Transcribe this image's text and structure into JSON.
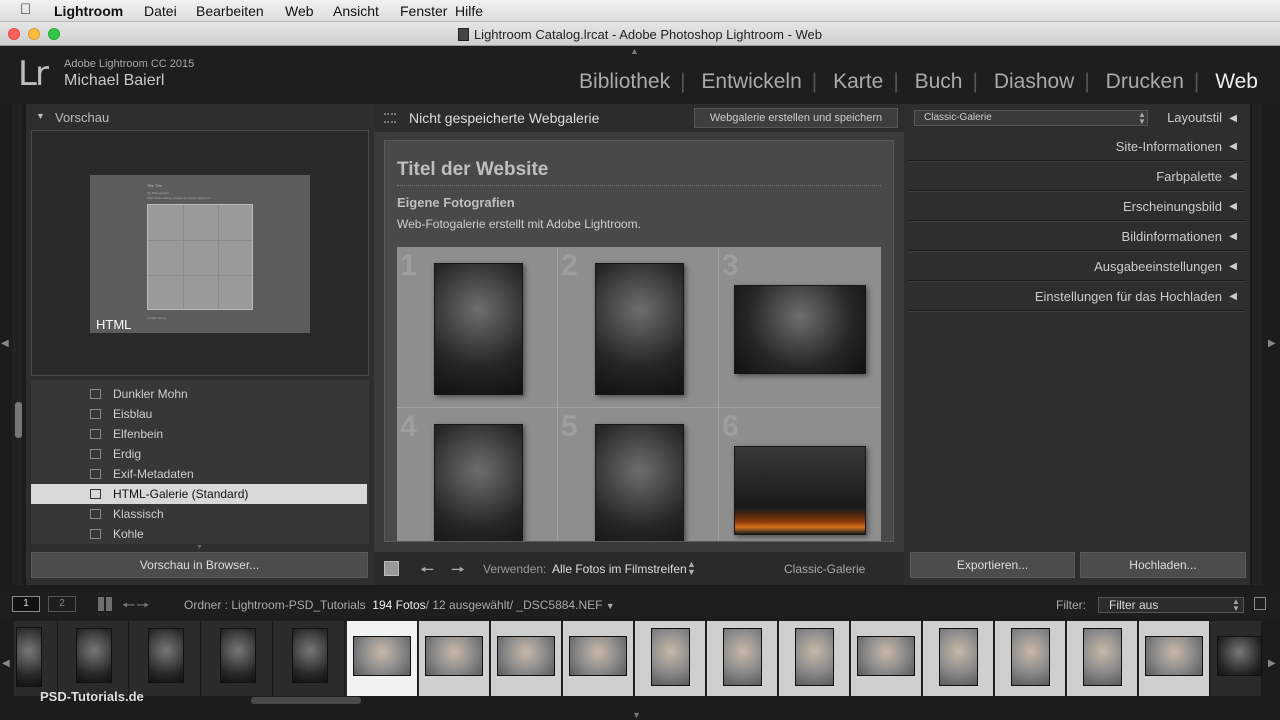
{
  "menubar": {
    "app": "Lightroom",
    "items": [
      "Datei",
      "Bearbeiten",
      "Web",
      "Ansicht",
      "Fenster",
      "Hilfe"
    ]
  },
  "window": {
    "title": "Lightroom Catalog.lrcat - Adobe Photoshop Lightroom - Web"
  },
  "identity": {
    "logo": "Lr",
    "product": "Adobe Lightroom CC 2015",
    "user": "Michael Baierl"
  },
  "modules": {
    "items": [
      "Bibliothek",
      "Entwickeln",
      "Karte",
      "Buch",
      "Diashow",
      "Drucken",
      "Web"
    ],
    "active": "Web"
  },
  "left": {
    "preview_title": "Vorschau",
    "preview_label": "HTML",
    "preview_mock": {
      "title": "Site Title",
      "line1": "My Photographs",
      "line2": "Web Photo Gallery created by Adobe Lightroom",
      "footer": "Contact Name"
    },
    "styles": [
      "Dunkler Mohn",
      "Eisblau",
      "Elfenbein",
      "Erdig",
      "Exif-Metadaten",
      "HTML-Galerie (Standard)",
      "Klassisch",
      "Kohle"
    ],
    "selected_style": "HTML-Galerie (Standard)",
    "preview_button": "Vorschau in Browser..."
  },
  "center": {
    "header_title": "Nicht gespeicherte Webgalerie",
    "save_button": "Webgalerie erstellen und speichern",
    "site_title": "Titel der Website",
    "collection_title": "Eigene Fotografien",
    "description": "Web-Fotogalerie erstellt mit Adobe Lightroom.",
    "cell_numbers": [
      "1",
      "2",
      "3",
      "4",
      "5",
      "6"
    ],
    "toolbar": {
      "use_label": "Verwenden:",
      "use_value": "Alle Fotos im Filmstreifen",
      "gallery_type": "Classic-Galerie"
    }
  },
  "right": {
    "layout_select": "Classic-Galerie",
    "layout_label": "Layoutstil",
    "sections": [
      "Site-Informationen",
      "Farbpalette",
      "Erscheinungsbild",
      "Bildinformationen",
      "Ausgabeeinstellungen",
      "Einstellungen für das Hochladen"
    ],
    "export_button": "Exportieren...",
    "upload_button": "Hochladen..."
  },
  "filmstrip": {
    "screen1": "1",
    "screen2": "2",
    "folder": "Ordner : Lightroom-PSD_Tutorials",
    "count": "194 Fotos",
    "selection": "/ 12 ausgewählt/ _DSC5884.NEF",
    "filter_label": "Filter:",
    "filter_value": "Filter aus",
    "watermark": "PSD-Tutorials.de"
  },
  "colors": {
    "selected_row": "#d8d8d8",
    "panel": "#2e2e2e",
    "accent_active": "#eeeeee"
  }
}
